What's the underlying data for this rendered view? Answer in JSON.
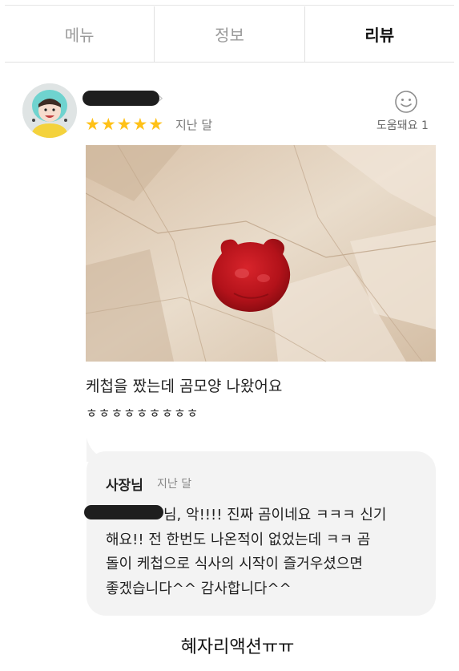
{
  "tabs": [
    {
      "label": "메뉴",
      "active": false
    },
    {
      "label": "정보",
      "active": false
    },
    {
      "label": "리뷰",
      "active": true
    }
  ],
  "review": {
    "rating": 5,
    "stars": "★★★★★",
    "date": "지난 달",
    "helpful_label": "도움돼요 1",
    "text_line1": "케첩을 짰는데 곰모양 나왔어요",
    "text_line2": "ㅎㅎㅎㅎㅎㅎㅎㅎㅎ"
  },
  "reply": {
    "author": "사장님",
    "date": "지난 달",
    "line1": "님, 악!!!! 진짜 곰이네요 ㅋㅋㅋ 신기",
    "line2": "해요!! 전 한번도 나온적이 없었는데 ㅋㅋ 곰",
    "line3": "돌이 케첩으로 식사의 시작이 즐거우셨으면",
    "line4": "좋겠습니다^^ 감사합니다^^"
  },
  "caption": "혜자리액션ㅠㅠ",
  "colors": {
    "star": "#ffc117",
    "reply_bg": "#f3f3f3",
    "ketchup": "#c8161d"
  },
  "icons": [
    "smile-icon",
    "chevron-right-icon",
    "star-icon"
  ]
}
